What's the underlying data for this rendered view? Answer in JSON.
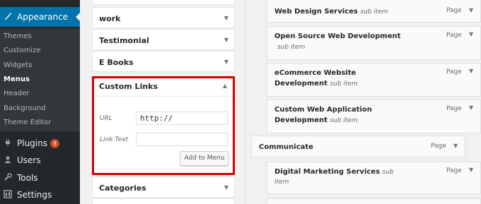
{
  "sidebar": {
    "appearance": "Appearance",
    "submenu": [
      "Themes",
      "Customize",
      "Widgets",
      "Menus",
      "Header",
      "Background",
      "Theme Editor"
    ],
    "plugins": "Plugins",
    "plugins_count": "8",
    "users": "Users",
    "tools": "Tools",
    "settings": "Settings"
  },
  "panels": {
    "work": "work",
    "testimonial": "Testimonial",
    "ebooks": "E Books",
    "custom_links": "Custom Links",
    "categories": "Categories"
  },
  "custom_links": {
    "url_label": "URL",
    "url_value": "http://",
    "link_text_label": "Link Text",
    "link_text_value": "",
    "add_button": "Add to Menu"
  },
  "menu_items": [
    {
      "title": "Web Design Services",
      "sub": "sub item",
      "type": "Page"
    },
    {
      "title": "Open Source Web Development",
      "sub": "sub item",
      "type": "Page"
    },
    {
      "title_line1": "eCommerce Website",
      "title_line2": "Development",
      "sub": "sub item",
      "type": "Page"
    },
    {
      "title_line1": "Custom Web Application",
      "title_line2": "Development",
      "sub": "sub item",
      "type": "Page"
    },
    {
      "title": "Communicate",
      "type": "Page"
    },
    {
      "title": "Digital Marketing Services",
      "sub_line1": "sub",
      "sub_line2": "item",
      "type": "Page"
    }
  ],
  "icons": {
    "appearance": "paintbrush-icon",
    "plugins": "plug-icon",
    "users": "user-icon",
    "tools": "wrench-icon",
    "settings": "settings-icon",
    "expand": "triangle-down-icon",
    "collapse": "triangle-up-icon"
  },
  "colors": {
    "sidebar_bg": "#23282d",
    "submenu_bg": "#32373c",
    "current_menu": "#0073aa",
    "highlight_border": "#d40000",
    "badge": "#ca4a1f"
  }
}
